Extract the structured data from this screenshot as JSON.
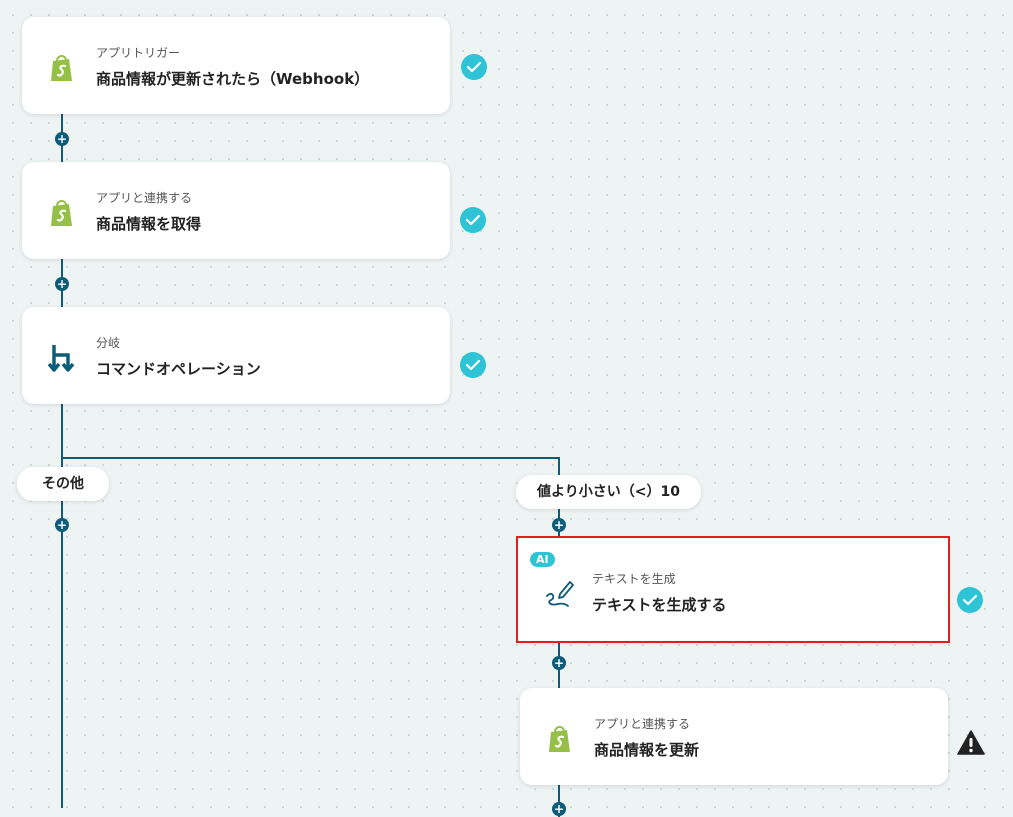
{
  "nodes": [
    {
      "sub": "アプリトリガー",
      "title": "商品情報が更新されたら（Webhook）",
      "icon": "shopify-icon",
      "status": "check"
    },
    {
      "sub": "アプリと連携する",
      "title": "商品情報を取得",
      "icon": "shopify-icon",
      "status": "check"
    },
    {
      "sub": "分岐",
      "title": "コマンドオペレーション",
      "icon": "branch-icon",
      "status": "check"
    },
    {
      "sub": "テキストを生成",
      "title": "テキストを生成する",
      "icon": "pen-icon",
      "badge": "AI",
      "status": "check"
    },
    {
      "sub": "アプリと連携する",
      "title": "商品情報を更新",
      "icon": "shopify-icon",
      "status": "warning"
    }
  ],
  "branches": {
    "left_label": "その他",
    "right_label": "値より小さい（<）10"
  },
  "plus_symbol": "+",
  "colors": {
    "line": "#0d5c7a",
    "check": "#2ec4d6",
    "shopify": "#95bf47",
    "selected_border": "#e02020"
  }
}
